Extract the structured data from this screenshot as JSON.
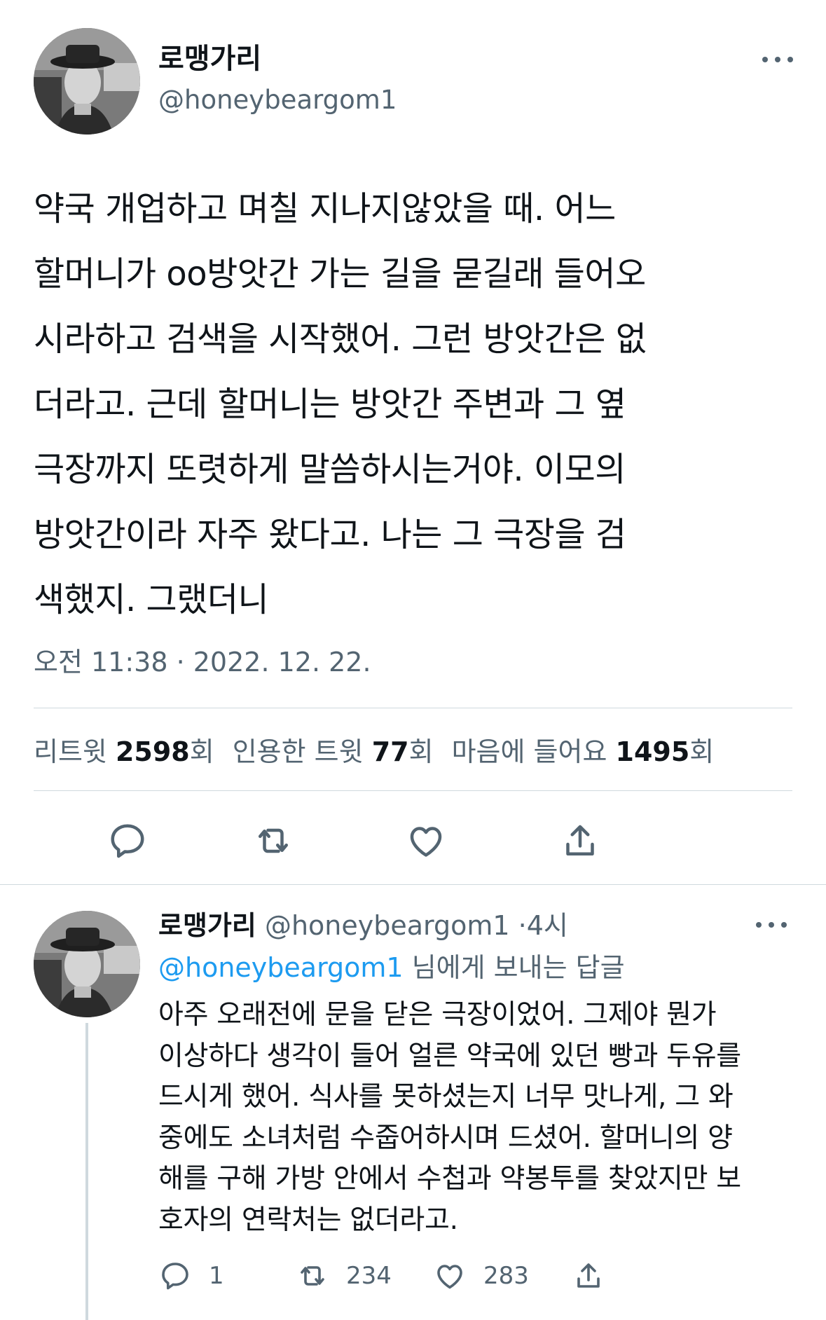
{
  "tweet": {
    "author_name": "로맹가리",
    "author_handle": "@honeybeargom1",
    "text": "약국 개업하고 며칠 지나지않았을 때. 어느\n할머니가 oo방앗간 가는 길을 묻길래 들어오\n시라하고 검색을 시작했어. 그런 방앗간은 없\n더라고. 근데 할머니는 방앗간 주변과 그 옆\n극장까지 또렷하게 말씀하시는거야. 이모의\n방앗간이라 자주 왔다고. 나는 그 극장을 검\n색했지. 그랬더니",
    "timestamp": "오전 11:38 · 2022. 12. 22.",
    "stats": {
      "retweets_label": "리트윗",
      "retweets_count": "2598",
      "retweets_unit": "회",
      "quotes_label": "인용한 트윗",
      "quotes_count": "77",
      "quotes_unit": "회",
      "likes_label": "마음에 들어요",
      "likes_count": "1495",
      "likes_unit": "회"
    },
    "actions": [
      "reply-icon",
      "retweet-icon",
      "like-icon",
      "share-icon"
    ]
  },
  "reply": {
    "author_name": "로맹가리",
    "author_handle": "@honeybeargom1",
    "separator": "·",
    "time_ago": "4시",
    "replying_to_handle": "@honeybeargom1",
    "replying_to_suffix": "님에게 보내는 답글",
    "text": "아주 오래전에 문을 닫은 극장이었어. 그제야 뭔가\n이상하다 생각이 들어 얼른 약국에 있던 빵과 두유를\n드시게 했어. 식사를 못하셨는지 너무 맛나게, 그 와\n중에도 소녀처럼 수줍어하시며 드셨어. 할머니의 양\n해를 구해 가방 안에서 수첩과 약봉투를 찾았지만 보\n호자의 연락처는 없더라고.",
    "reply_count": "1",
    "retweet_count": "234",
    "like_count": "283"
  },
  "colors": {
    "text": "#0f1419",
    "secondary": "#536471",
    "link": "#1d9bf0",
    "divider": "#cfd9de"
  }
}
